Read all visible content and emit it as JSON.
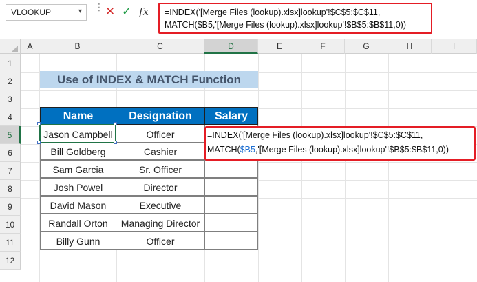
{
  "formula_bar": {
    "name_box": "VLOOKUP",
    "fx_label": "fx",
    "formula_line1": "=INDEX('[Merge Files (lookup).xlsx]lookup'!$C$5:$C$11,",
    "formula_line2": "MATCH($B5,'[Merge Files (lookup).xlsx]lookup'!$B$5:$B$11,0))"
  },
  "columns": [
    "A",
    "B",
    "C",
    "D",
    "E",
    "F",
    "G",
    "H",
    "I"
  ],
  "rows": [
    "1",
    "2",
    "3",
    "4",
    "5",
    "6",
    "7",
    "8",
    "9",
    "10",
    "11",
    "12"
  ],
  "title": "Use of INDEX & MATCH Function",
  "table": {
    "headers": [
      "Name",
      "Designation",
      "Salary"
    ],
    "rows": [
      {
        "name": "Jason Campbell",
        "designation": "Officer"
      },
      {
        "name": "Bill Goldberg",
        "designation": "Cashier"
      },
      {
        "name": "Sam Garcia",
        "designation": "Sr. Officer"
      },
      {
        "name": "Josh Powel",
        "designation": "Director"
      },
      {
        "name": "David Mason",
        "designation": "Executive"
      },
      {
        "name": "Randall Orton",
        "designation": "Managing Director"
      },
      {
        "name": "Billy Gunn",
        "designation": "Officer"
      }
    ]
  },
  "cell_formula": {
    "line1": "=INDEX('[Merge Files (lookup).xlsx]lookup'!$C$5:$C$11,",
    "line2_prefix": "MATCH(",
    "line2_ref": "$B5",
    "line2_suffix": ",'[Merge Files (lookup).xlsx]lookup'!$B$5:$B$11,0))"
  },
  "colors": {
    "header_blue": "#0070c0",
    "title_fill": "#bdd7ee",
    "highlight_red": "#e41d25",
    "excel_green": "#217346"
  }
}
